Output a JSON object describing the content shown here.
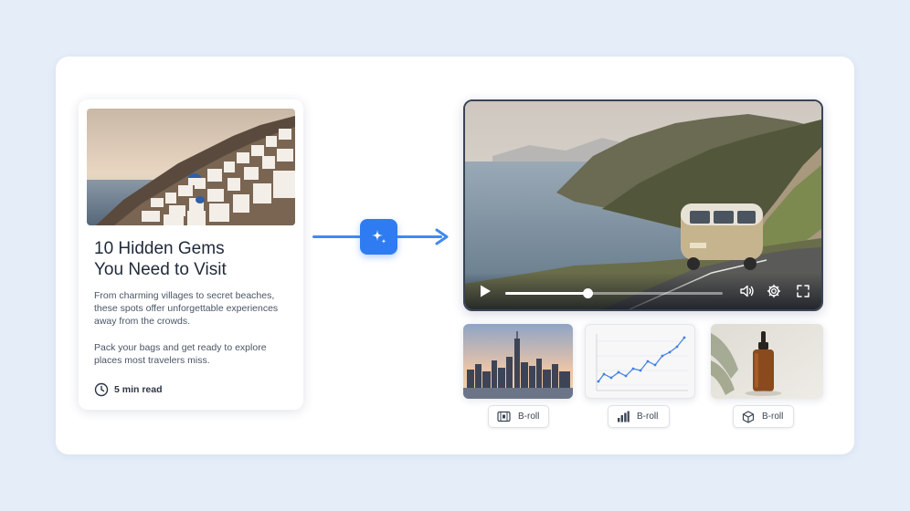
{
  "article": {
    "title_line1": "10 Hidden Gems",
    "title_line2": "You Need to Visit",
    "paragraph1": "From charming villages to secret beaches, these spots offer unforgettable experiences away from the crowds.",
    "paragraph2": "Pack your bags and get ready to explore places most travelers miss.",
    "read_time": "5 min read",
    "image": "santorini-cliff-village-photo"
  },
  "convert": {
    "icon": "sparkle-icon",
    "accent": "#2f7cf2"
  },
  "player": {
    "scene": "van-on-coastal-road-video",
    "progress": 0.38,
    "controls": [
      "play-icon",
      "volume-icon",
      "settings-icon",
      "fullscreen-icon"
    ]
  },
  "broll": [
    {
      "thumbnail": "city-skyline-photo",
      "icon": "film-icon",
      "label": "B-roll"
    },
    {
      "thumbnail": "line-chart-graphic",
      "icon": "bar-chart-icon",
      "label": "B-roll"
    },
    {
      "thumbnail": "serum-bottle-photo",
      "icon": "cube-icon",
      "label": "B-roll"
    }
  ]
}
